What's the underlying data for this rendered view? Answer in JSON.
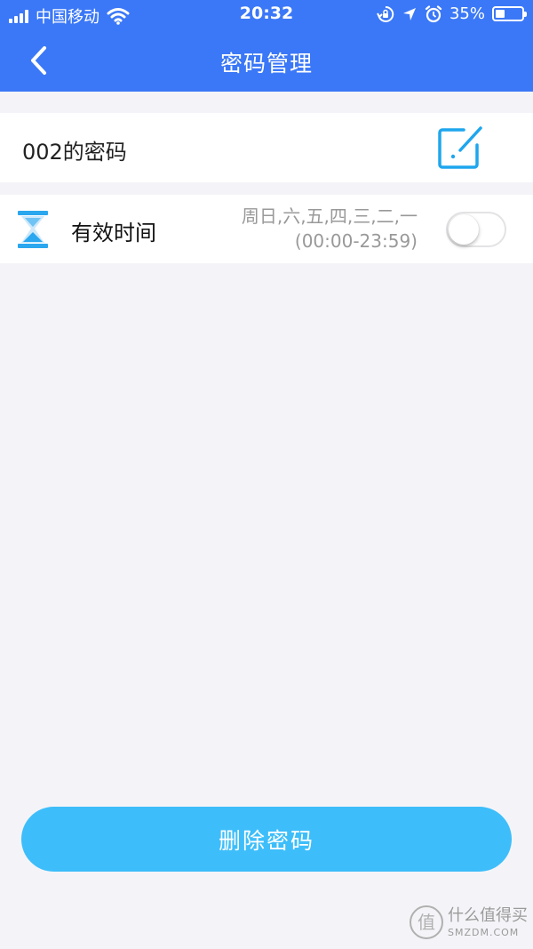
{
  "status_bar": {
    "carrier": "中国移动",
    "time": "20:32",
    "battery_percent": "35%",
    "battery_level": 0.35,
    "icons": [
      "signal-icon",
      "wifi-icon",
      "lock-rotation-icon",
      "location-icon",
      "alarm-icon",
      "battery-icon"
    ]
  },
  "nav": {
    "title": "密码管理",
    "back_icon": "chevron-left-icon"
  },
  "password": {
    "name": "002的密码",
    "edit_icon": "edit-icon"
  },
  "validity": {
    "label": "有效时间",
    "days": "周日,六,五,四,三,二,一",
    "hours": "(00:00-23:59)",
    "enabled": false,
    "icon": "hourglass-icon"
  },
  "actions": {
    "delete_label": "删除密码"
  },
  "watermark": {
    "cn": "什么值得买",
    "en": "SMZDM.COM"
  },
  "colors": {
    "header": "#3b78f7",
    "accent": "#1ea6ee",
    "button": "#3dbefa",
    "background": "#f4f4f8"
  }
}
